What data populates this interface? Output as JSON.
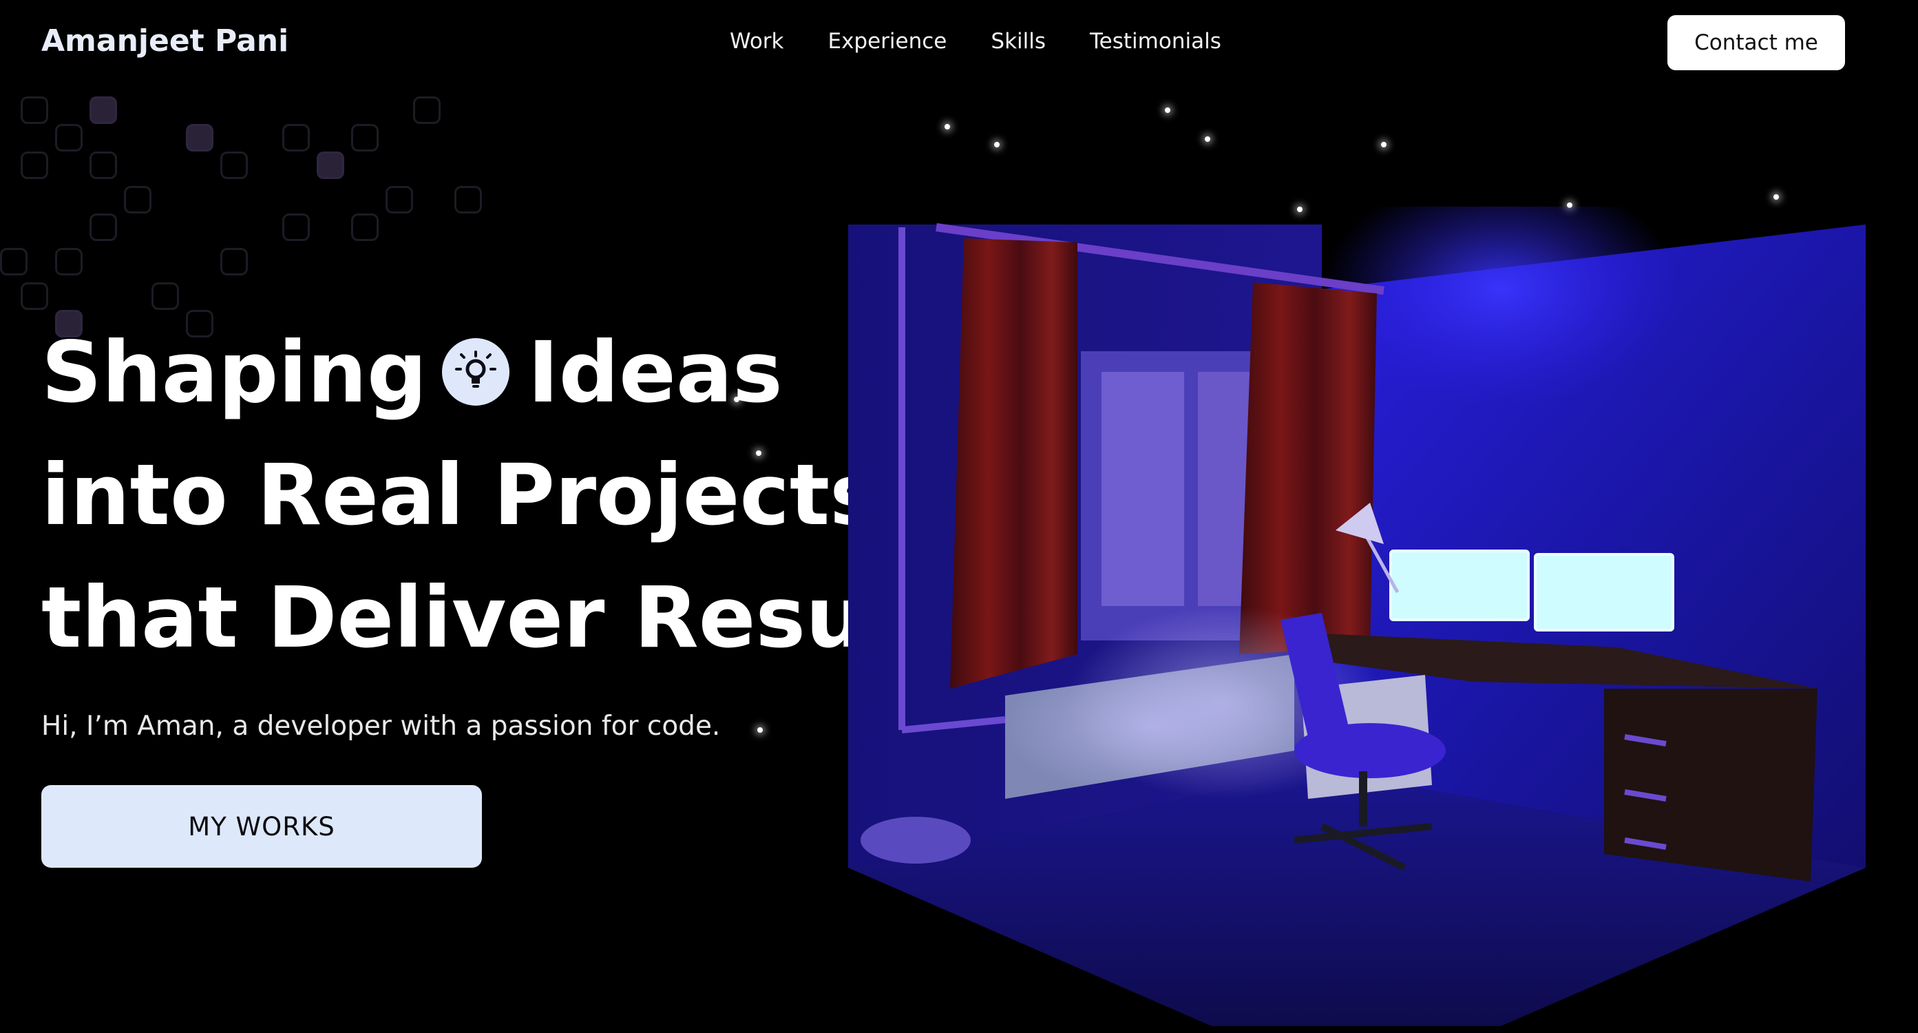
{
  "header": {
    "brand": "Amanjeet Pani",
    "nav": [
      "Work",
      "Experience",
      "Skills",
      "Testimonials"
    ],
    "contact_label": "Contact me"
  },
  "hero": {
    "headline_1": "Shaping",
    "headline_1b": "Ideas",
    "headline_2": "into Real Projects",
    "headline_3": "that Deliver Results",
    "icon": "lightbulb-icon",
    "subtitle": "Hi, I’m Aman, a developer with a passion for code.",
    "cta_label": "MY WORKS"
  },
  "colors": {
    "background": "#000000",
    "button_light": "#dde8fb",
    "room_blue": "#1a14b8",
    "curtain_red": "#7a1616",
    "monitor_glow": "#cffcff"
  }
}
